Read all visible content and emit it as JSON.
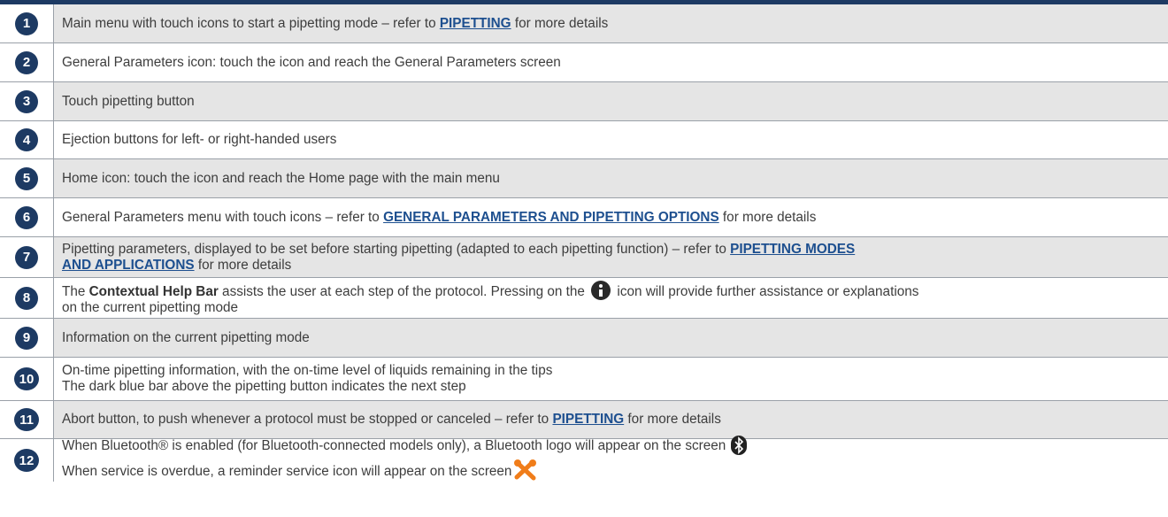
{
  "rows": [
    {
      "num": "1",
      "parts": [
        "Main menu with touch icons to start a pipetting mode – refer to ",
        "PIPETTING",
        " for more details"
      ]
    },
    {
      "num": "2",
      "text": "General Parameters icon: touch the icon and reach the General Parameters screen"
    },
    {
      "num": "3",
      "text": "Touch pipetting button"
    },
    {
      "num": "4",
      "text": "Ejection buttons for left- or right-handed users"
    },
    {
      "num": "5",
      "text": "Home icon: touch the icon and reach the Home page with the main menu"
    },
    {
      "num": "6",
      "parts": [
        "General Parameters menu with touch icons – refer to ",
        "GENERAL PARAMETERS AND PIPETTING OPTIONS",
        " for more details"
      ]
    },
    {
      "num": "7",
      "line1": "Pipetting parameters, displayed to be set before starting pipetting (adapted to each pipetting function) – refer to ",
      "link1": "PIPETTING MODES",
      "link2": "AND APPLICATIONS",
      "tail": " for more details"
    },
    {
      "num": "8",
      "pre": "The ",
      "bold": "Contextual Help Bar",
      "mid": " assists the user at each step of the protocol. Pressing on the ",
      "post": " icon will provide further assistance or explanations",
      "line2": "on the current pipetting mode"
    },
    {
      "num": "9",
      "text": "Information on the current pipetting mode"
    },
    {
      "num": "10",
      "line1": "On-time pipetting information, with the on-time level of liquids remaining in the tips",
      "line2": "The dark blue bar above the pipetting button indicates the next step"
    },
    {
      "num": "11",
      "parts": [
        "Abort button, to push whenever a protocol must be stopped or canceled – refer to ",
        "PIPETTING",
        " for more details"
      ]
    },
    {
      "num": "12",
      "line1": "When Bluetooth® is enabled (for Bluetooth-connected models only), a Bluetooth logo will appear on the screen",
      "line2": "When service is overdue, a reminder service icon will appear on the screen"
    }
  ],
  "icons": {
    "info": "info-icon",
    "bluetooth": "bluetooth-icon",
    "service": "service-tools-icon"
  },
  "colors": {
    "badge": "#1d3a63",
    "link": "#1d4f8f",
    "shade": "#e5e5e5",
    "service": "#f07d1a"
  }
}
